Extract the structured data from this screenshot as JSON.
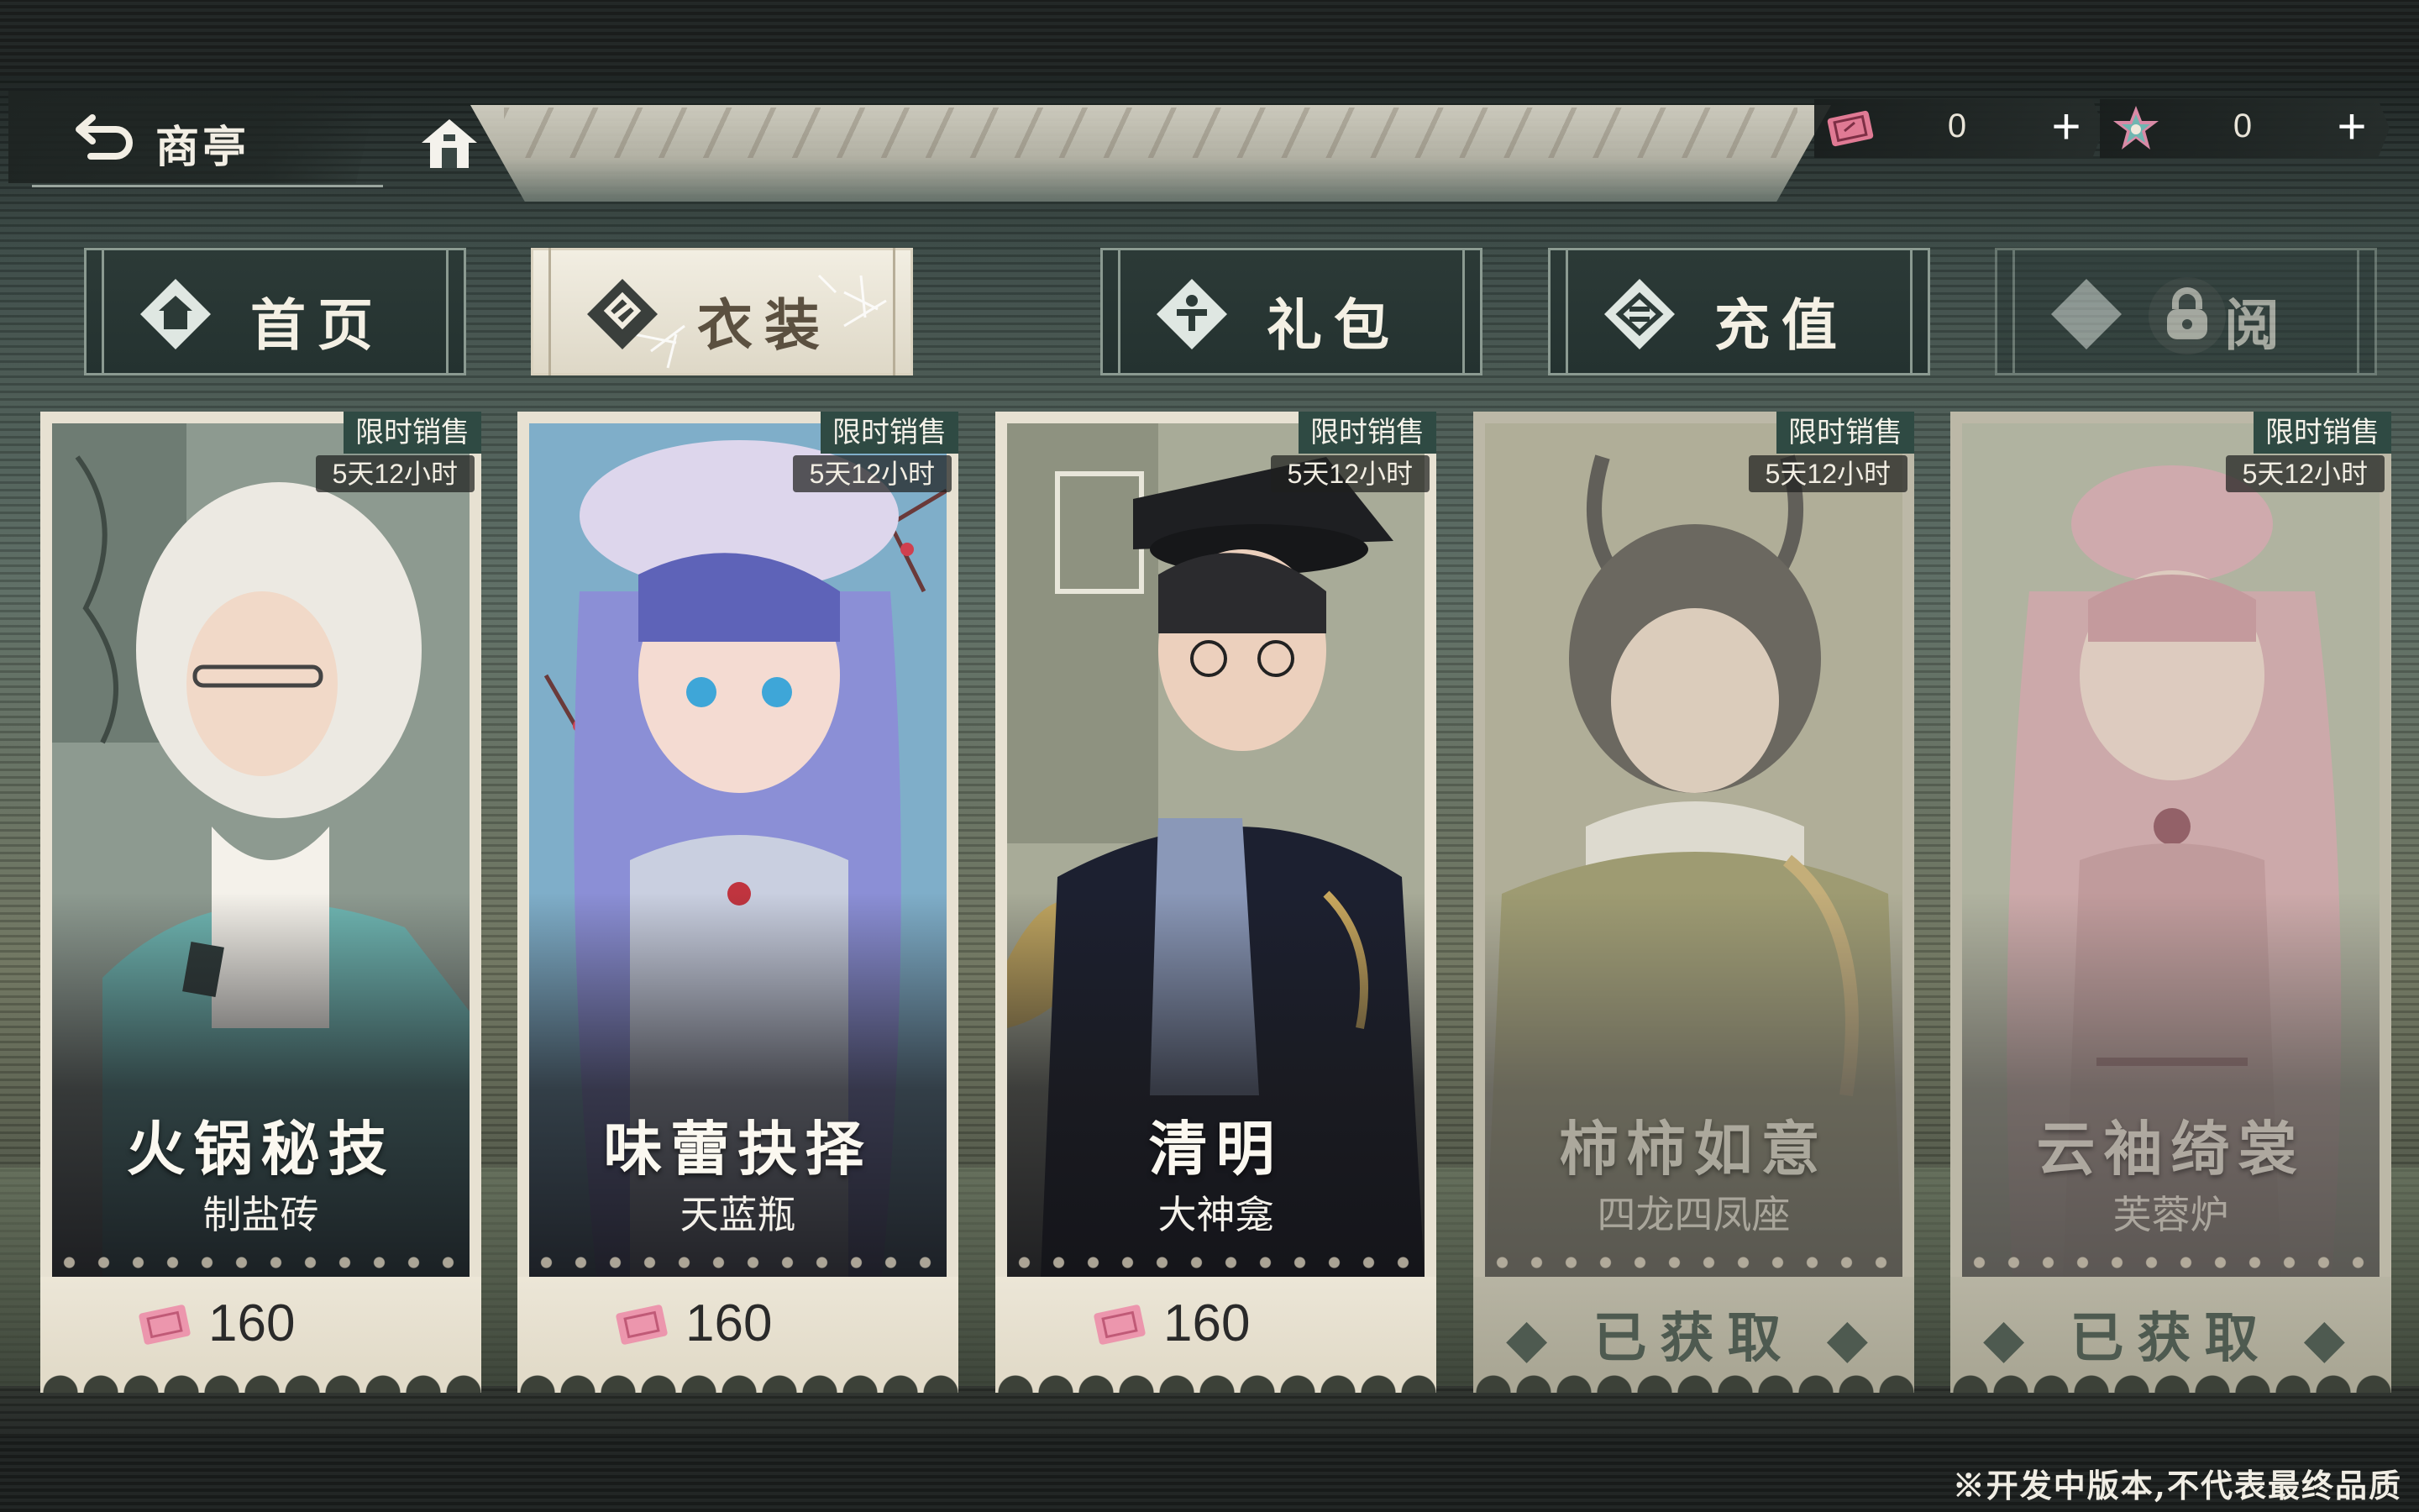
{
  "header": {
    "back_title": "商亭",
    "back_icon": "back-arrow-icon",
    "home_icon": "home-icon"
  },
  "currencies": [
    {
      "icon": "ticket-icon",
      "value": "0",
      "plus": "+"
    },
    {
      "icon": "star-gem-icon",
      "value": "0",
      "plus": "+"
    }
  ],
  "tabs": [
    {
      "label": "首页",
      "icon": "home-diamond-icon",
      "active": false
    },
    {
      "label": "衣装",
      "icon": "hanger-diamond-icon",
      "active": true
    },
    {
      "label": "礼包",
      "icon": "gift-diamond-icon",
      "active": false
    },
    {
      "label": "充值",
      "icon": "coin-diamond-icon",
      "active": false
    },
    {
      "label": "阅",
      "icon": "lock-icon",
      "active": false,
      "locked": true
    }
  ],
  "cards": [
    {
      "title": "火锅秘技",
      "subtitle": "制盐砖",
      "badge": "限时销售",
      "timer": "5天12小时",
      "price": "160",
      "owned": false
    },
    {
      "title": "味蕾抉择",
      "subtitle": "天蓝瓶",
      "badge": "限时销售",
      "timer": "5天12小时",
      "price": "160",
      "owned": false
    },
    {
      "title": "清明",
      "subtitle": "大神龛",
      "badge": "限时销售",
      "timer": "5天12小时",
      "price": "160",
      "owned": false
    },
    {
      "title": "柿柿如意",
      "subtitle": "四龙四凤座",
      "badge": "限时销售",
      "timer": "5天12小时",
      "status": "已获取",
      "owned": true
    },
    {
      "title": "云袖绮裳",
      "subtitle": "芙蓉炉",
      "badge": "限时销售",
      "timer": "5天12小时",
      "status": "已获取",
      "owned": true
    }
  ],
  "footer": {
    "disclaimer": "※开发中版本,不代表最终品质"
  },
  "colors": {
    "tab_bg": "#2c3a37",
    "tab_active": "#f2eee2",
    "badge": "#2f4a43",
    "ticket": "#e07a94"
  }
}
